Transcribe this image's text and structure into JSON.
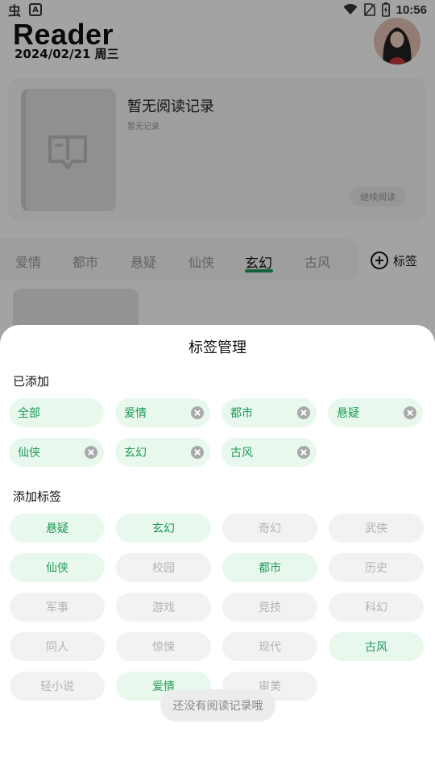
{
  "status_bar": {
    "left_icons": [
      "bug-app-icon",
      "text-a-icon"
    ],
    "right_icons": [
      "wifi-icon",
      "no-sim-icon",
      "battery-charging-icon"
    ],
    "time": "10:56"
  },
  "header": {
    "app_title": "Reader",
    "date": "2024/02/21 周三"
  },
  "recent_card": {
    "title": "暂无阅读记录",
    "subtitle": "暂无记录",
    "continue_label": "继续阅读"
  },
  "category_tabs": {
    "items": [
      "爱情",
      "都市",
      "悬疑",
      "仙侠",
      "玄幻",
      "古风"
    ],
    "active": "玄幻",
    "tag_button_label": "标签"
  },
  "tag_sheet": {
    "title": "标签管理",
    "added_section_label": "已添加",
    "added_tags": [
      {
        "label": "全部",
        "removable": false
      },
      {
        "label": "爱情",
        "removable": true
      },
      {
        "label": "都市",
        "removable": true
      },
      {
        "label": "悬疑",
        "removable": true
      },
      {
        "label": "仙侠",
        "removable": true
      },
      {
        "label": "玄幻",
        "removable": true
      },
      {
        "label": "古风",
        "removable": true
      }
    ],
    "add_section_label": "添加标签",
    "available_tags": [
      {
        "label": "悬疑",
        "selected": true
      },
      {
        "label": "玄幻",
        "selected": true
      },
      {
        "label": "奇幻",
        "selected": false
      },
      {
        "label": "武侠",
        "selected": false
      },
      {
        "label": "仙侠",
        "selected": true
      },
      {
        "label": "校园",
        "selected": false
      },
      {
        "label": "都市",
        "selected": true
      },
      {
        "label": "历史",
        "selected": false
      },
      {
        "label": "军事",
        "selected": false
      },
      {
        "label": "游戏",
        "selected": false
      },
      {
        "label": "竞技",
        "selected": false
      },
      {
        "label": "科幻",
        "selected": false
      },
      {
        "label": "同人",
        "selected": false
      },
      {
        "label": "惊悚",
        "selected": false
      },
      {
        "label": "现代",
        "selected": false
      },
      {
        "label": "古风",
        "selected": true
      },
      {
        "label": "轻小说",
        "selected": false
      },
      {
        "label": "爱情",
        "selected": true
      },
      {
        "label": "审美",
        "selected": false
      }
    ]
  },
  "toast": {
    "message": "还没有阅读记录哦"
  },
  "colors": {
    "accent_green": "#1e9a5a",
    "chip_selected_bg": "#e9f8ec",
    "chip_unselected_bg": "#f2f2f2"
  }
}
